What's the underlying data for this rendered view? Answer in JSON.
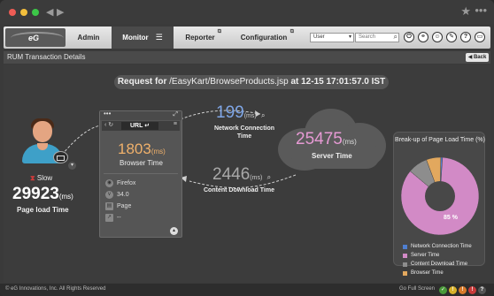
{
  "window": {
    "back_arrow": "◀",
    "forward_arrow": "▶",
    "star": "★",
    "menu": "•••"
  },
  "header": {
    "logo": "eG",
    "tabs": [
      "Admin",
      "Monitor",
      "Reporter",
      "Configuration"
    ],
    "active_tab": "Monitor",
    "user_select": "User",
    "search_placeholder": "Search",
    "icons": [
      "power-icon",
      "link-icon",
      "user-icon",
      "wrench-icon",
      "help-icon",
      "ruler-icon"
    ]
  },
  "subheader": {
    "title": "RUM Transaction Details",
    "back_label": "◀ Back"
  },
  "request": {
    "prefix": "Request for",
    "path": "/EasyKart/BrowseProducts.jsp",
    "at": "at",
    "time": "12-15 17:01:57.0 IST"
  },
  "user": {
    "status": "Slow",
    "page_load_time": "29923",
    "unit": "(ms)",
    "page_load_label": "Page load Time"
  },
  "browser": {
    "url_label": "URL",
    "browser_time": "1803",
    "unit": "(ms)",
    "browser_time_label": "Browser Time",
    "browser_name": "Firefox",
    "browser_version": "34.0",
    "page_label": "Page",
    "extra": "--"
  },
  "metrics": {
    "network_time": "199",
    "network_unit": "(ms)",
    "network_label": "Network Connection Time",
    "server_time": "25475",
    "server_unit": "(ms)",
    "server_label": "Server Time",
    "download_time": "2446",
    "download_unit": "(ms)",
    "download_label": "Content Download Time"
  },
  "breakup": {
    "title": "Break-up of Page Load Time (%)",
    "pie_label": "85 %",
    "legend": [
      {
        "label": "Network Connection Time",
        "color": "#4f7fd1"
      },
      {
        "label": "Server Time",
        "color": "#d28ac6"
      },
      {
        "label": "Content Download Time",
        "color": "#8d8d8d"
      },
      {
        "label": "Browser Time",
        "color": "#e2a85e"
      }
    ]
  },
  "chart_data": {
    "type": "pie",
    "title": "Break-up of Page Load Time (%)",
    "categories": [
      "Network Connection Time",
      "Server Time",
      "Content Download Time",
      "Browser Time"
    ],
    "values": [
      0.7,
      85.1,
      8.2,
      6.0
    ]
  },
  "footer": {
    "copyright": "© eG Innovations, Inc. All Rights Reserved",
    "fullscreen": "Go Full Screen"
  }
}
